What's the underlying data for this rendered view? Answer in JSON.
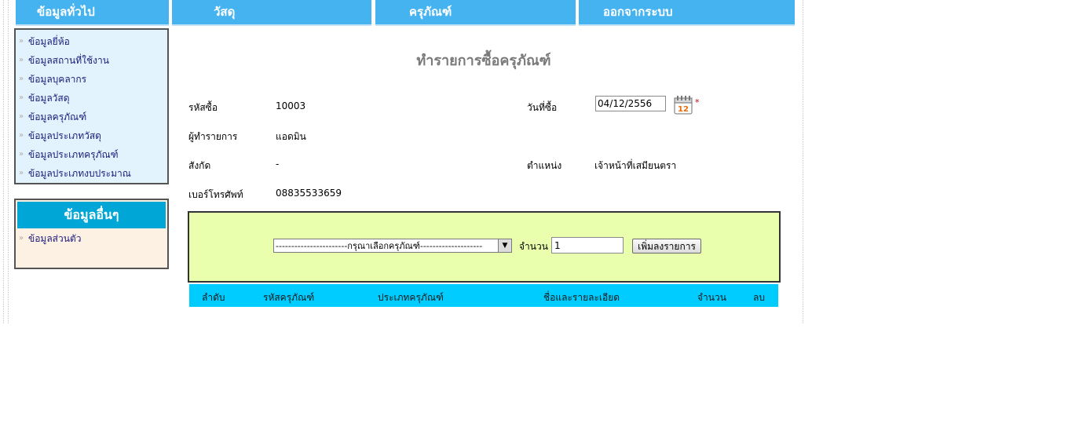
{
  "nav": {
    "general": "ข้อมูลทั่วไป",
    "material": "วัสดุ",
    "equipment": "ครุภัณฑ์",
    "logout": "ออกจากระบบ"
  },
  "sidebar": {
    "items": [
      {
        "label": "ข้อมูลยี่ห้อ"
      },
      {
        "label": "ข้อมูลสถานที่ใช้งาน"
      },
      {
        "label": "ข้อมูลบุคลากร"
      },
      {
        "label": "ข้อมูลวัสดุ"
      },
      {
        "label": "ข้อมูลครุภัณฑ์"
      },
      {
        "label": "ข้อมูลประเภทวัสดุ"
      },
      {
        "label": "ข้อมูลประเภทครุภัณฑ์"
      },
      {
        "label": "ข้อมูลประเภทงบประมาณ"
      }
    ],
    "other_title": "ข้อมูลอื่นๆ",
    "other_items": [
      {
        "label": "ข้อมูลส่วนตัว"
      }
    ]
  },
  "page": {
    "title": "ทำรายการซื้อครุภัณฑ์"
  },
  "form": {
    "purchase_id_label": "รหัสซื้อ",
    "purchase_id": "10003",
    "buy_date_label": "วันที่ซื้อ",
    "buy_date": "04/12/2556",
    "required_mark": "*",
    "operator_label": "ผู้ทำรายการ",
    "operator": "แอดมิน",
    "affiliation_label": "สังกัด",
    "affiliation": "-",
    "position_label": "ตำแหน่ง",
    "position": "เจ้าหน้าที่เสมียนตรา",
    "phone_label": "เบอร์โทรศัพท์",
    "phone": "08835533659"
  },
  "add_item": {
    "select_value": "-----------------------กรุณาเลือกครุภัณฑ์--------------------",
    "qty_label": "จำนวน",
    "qty_value": "1",
    "add_button": "เพิ่มลงรายการ"
  },
  "table": {
    "columns": [
      "ลำดับ",
      "รหัสครุภัณฑ์",
      "ประเภทครุภัณฑ์",
      "ชื่อและรายละเอียด",
      "จำนวน",
      "ลบ"
    ]
  },
  "colors": {
    "nav_bg": "#45b3f0",
    "sidebar_bg": "#e3f3fd",
    "add_box_bg": "#e9ffad",
    "table_header_bg": "#00ccff"
  },
  "icons": {
    "calendar": "calendar-icon",
    "chevron": "double-chevron-icon"
  }
}
